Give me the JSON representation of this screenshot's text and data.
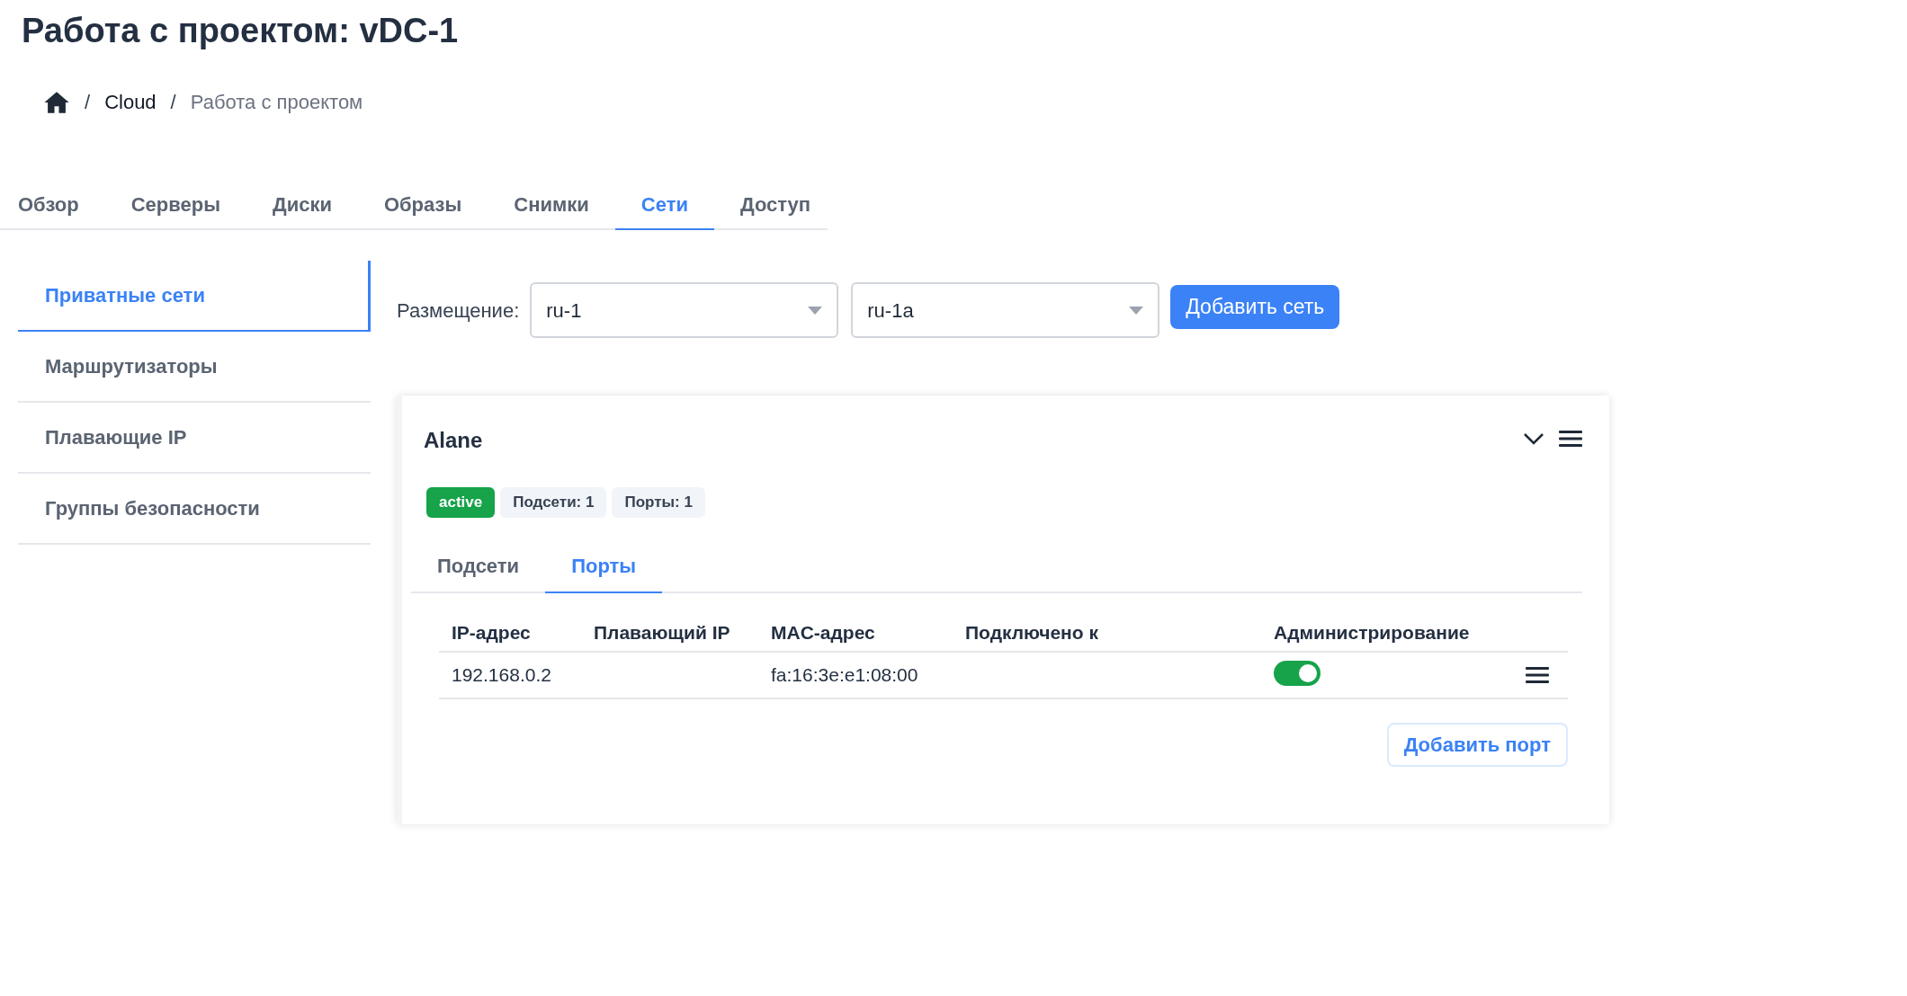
{
  "page_title": "Работа с проектом: vDC-1",
  "breadcrumb": [
    {
      "separator": "/",
      "label": "Cloud",
      "current": false
    },
    {
      "separator": "/",
      "label": "Работа с проектом",
      "current": true
    }
  ],
  "tabs": [
    {
      "label": "Обзор",
      "selected": false
    },
    {
      "label": "Серверы",
      "selected": false
    },
    {
      "label": "Диски",
      "selected": false
    },
    {
      "label": "Образы",
      "selected": false
    },
    {
      "label": "Снимки",
      "selected": false
    },
    {
      "label": "Сети",
      "selected": true
    },
    {
      "label": "Доступ",
      "selected": false
    }
  ],
  "sidebar": {
    "items": [
      {
        "label": "Приватные сети",
        "selected": true
      },
      {
        "label": "Маршрутизаторы",
        "selected": false
      },
      {
        "label": "Плавающие IP",
        "selected": false
      },
      {
        "label": "Группы безопасности",
        "selected": false
      }
    ]
  },
  "placement": {
    "label": "Размещение:",
    "region": "ru-1",
    "zone": "ru-1a",
    "add_button": "Добавить сеть"
  },
  "network": {
    "name": "Alane",
    "badges": [
      {
        "label": "active",
        "color": "#16a34a"
      },
      {
        "label": "Подсети: 1",
        "color": "#f1f5f9"
      },
      {
        "label": "Порты: 1",
        "color": "#f1f5f9"
      }
    ],
    "tabs": [
      {
        "label": "Подсети",
        "selected": false
      },
      {
        "label": "Порты",
        "selected": true
      }
    ],
    "table": {
      "columns": [
        "IP-адрес",
        "Плавающий IP",
        "MAC-адрес",
        "Подключено к",
        "Администрирование"
      ],
      "rows": [
        {
          "ip": "192.168.0.2",
          "mac": "fa:16:3e:e1:08:00",
          "admin_on": true
        }
      ]
    },
    "add_port_button": "Добавить порт"
  }
}
